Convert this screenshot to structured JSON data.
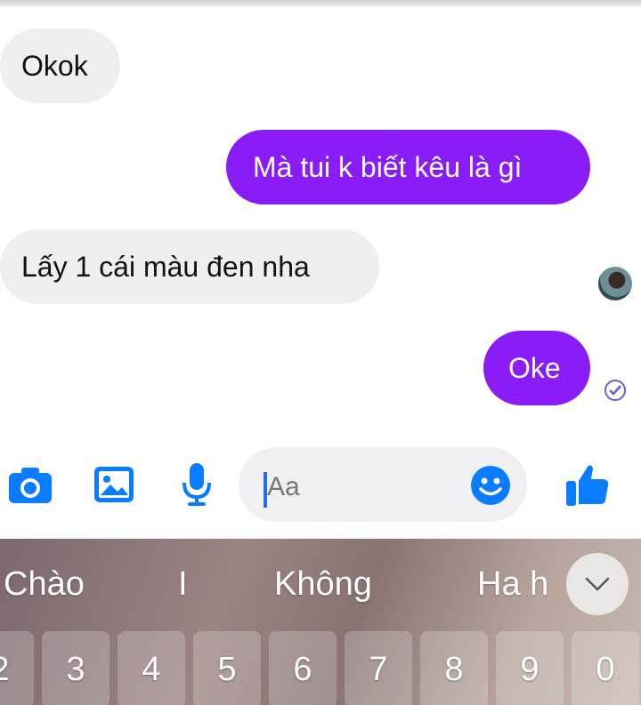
{
  "messages": [
    {
      "side": "in",
      "text": "Okok"
    },
    {
      "side": "out",
      "text": "Mà tui k biết kêu là gì"
    },
    {
      "side": "in",
      "text": "Lấy 1 cái màu đen nha"
    },
    {
      "side": "out",
      "text": "Oke"
    }
  ],
  "composer": {
    "placeholder": "Aa",
    "icons": [
      "camera-icon",
      "image-icon",
      "microphone-icon",
      "emoji-icon",
      "thumbs-up-icon"
    ]
  },
  "keyboard": {
    "suggestions": [
      "Chào",
      "I",
      "Không",
      "Ha h"
    ],
    "number_keys": [
      "2",
      "3",
      "4",
      "5",
      "6",
      "7",
      "8",
      "9",
      "0"
    ]
  },
  "colors": {
    "outgoing_bubble": "#8a1cf7",
    "incoming_bubble": "#efeff1",
    "icon_blue": "#0a7cff"
  }
}
